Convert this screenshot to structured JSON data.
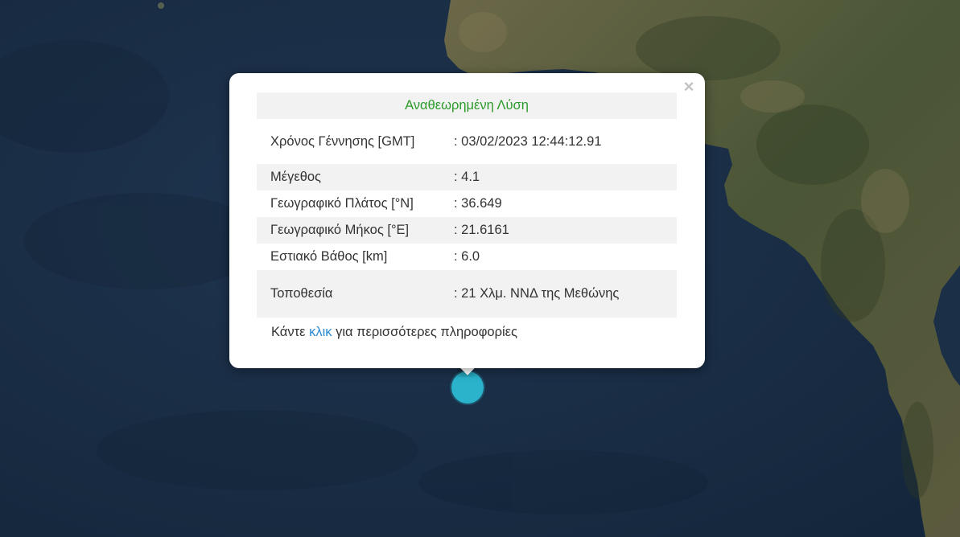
{
  "popup": {
    "header": "Αναθεωρημένη Λύση",
    "close_symbol": "×",
    "rows": [
      {
        "key": "Χρόνος Γέννησης [GMT]",
        "value": ": 03/02/2023 12:44:12.91"
      },
      {
        "key": "Μέγεθος",
        "value": ": 4.1"
      },
      {
        "key": "Γεωγραφικό Πλάτος [°N]",
        "value": ": 36.649"
      },
      {
        "key": "Γεωγραφικό Μήκος [°E]",
        "value": ": 21.6161"
      },
      {
        "key": "Εστιακό Βάθος [km]",
        "value": ": 6.0"
      },
      {
        "key": "Τοποθεσία",
        "value": ": 21 Χλμ. ΝΝΔ της Μεθώνης"
      }
    ],
    "footer": {
      "prefix": "Κάντε ",
      "link": "κλικ",
      "suffix": " για περισσότερες πληροφορίες"
    }
  },
  "map": {
    "sea_color": "#1b2f47",
    "land_color": "#4d5a3a",
    "marker_color": "#2bb3cc",
    "marker_icon": "earthquake-marker"
  }
}
